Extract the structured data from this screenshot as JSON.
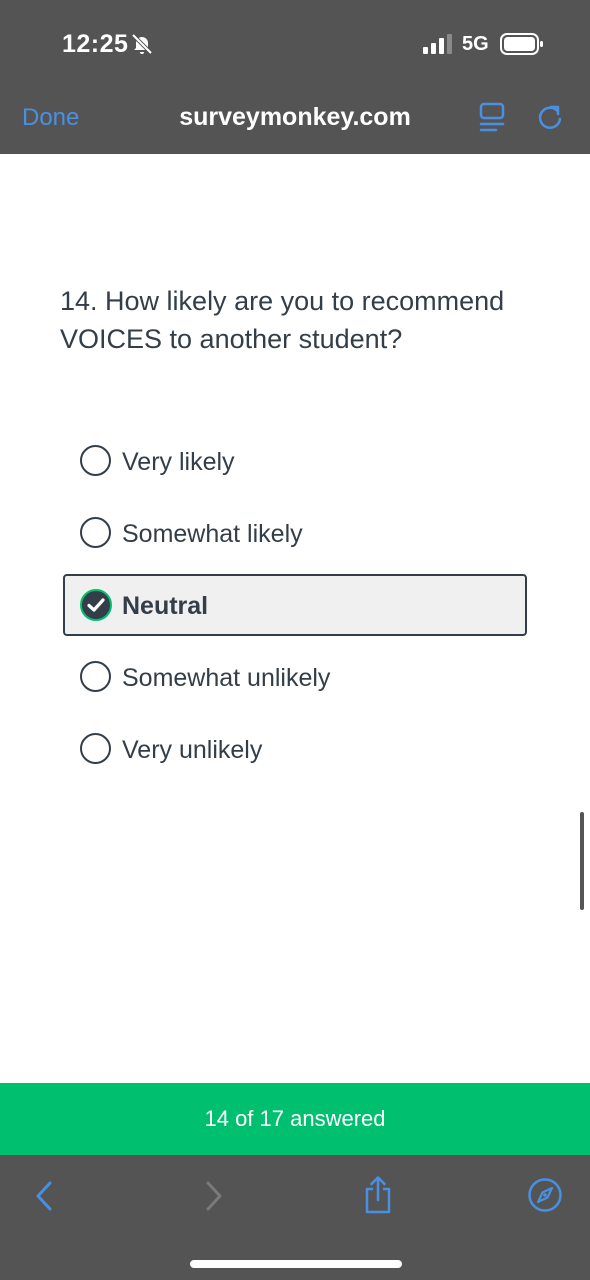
{
  "status_bar": {
    "time": "12:25",
    "network": "5G",
    "icons": [
      "bell-slash-icon",
      "signal-icon",
      "battery-icon"
    ]
  },
  "browser": {
    "done_label": "Done",
    "url": "surveymonkey.com",
    "accent_color": "#4a90e2",
    "icons": [
      "reader-mode-icon",
      "reload-icon",
      "back-icon",
      "forward-icon",
      "share-icon",
      "compass-icon"
    ]
  },
  "question": {
    "text": "14. How likely are you to recommend VOICES to another student?",
    "options": [
      {
        "label": "Very likely",
        "selected": false
      },
      {
        "label": "Somewhat likely",
        "selected": false
      },
      {
        "label": "Neutral",
        "selected": true
      },
      {
        "label": "Somewhat unlikely",
        "selected": false
      },
      {
        "label": "Very unlikely",
        "selected": false
      }
    ]
  },
  "progress": {
    "text": "14 of 17 answered",
    "answered": 14,
    "total": 17,
    "color": "#00bf6f"
  }
}
